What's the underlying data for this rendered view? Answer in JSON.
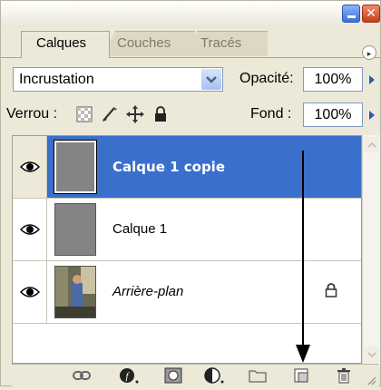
{
  "tabs": [
    {
      "label": "Calques"
    },
    {
      "label": "Couches"
    },
    {
      "label": "Tracés"
    }
  ],
  "blend": {
    "mode": "Incrustation"
  },
  "opacity": {
    "label": "Opacité:",
    "value": "100%"
  },
  "lock": {
    "label": "Verrou :"
  },
  "fill": {
    "label": "Fond :",
    "value": "100%"
  },
  "layers": [
    {
      "name": "Calque 1 copie",
      "selected": true
    },
    {
      "name": "Calque 1",
      "selected": false
    },
    {
      "name": "Arrière-plan",
      "selected": false,
      "locked": true
    }
  ],
  "icons": {
    "window": [
      "minimize-icon",
      "close-icon"
    ],
    "lock": [
      "lock-transparent-icon",
      "lock-paint-icon",
      "lock-move-icon",
      "lock-all-icon"
    ],
    "toolbar": [
      "link-icon",
      "layer-style-icon",
      "layer-mask-icon",
      "adjustment-layer-icon",
      "new-group-icon",
      "new-layer-icon",
      "trash-icon"
    ]
  },
  "colors": {
    "selection": "#3a6fcc",
    "panel": "#ece9d8",
    "thumbnail_gray": "#848484"
  }
}
